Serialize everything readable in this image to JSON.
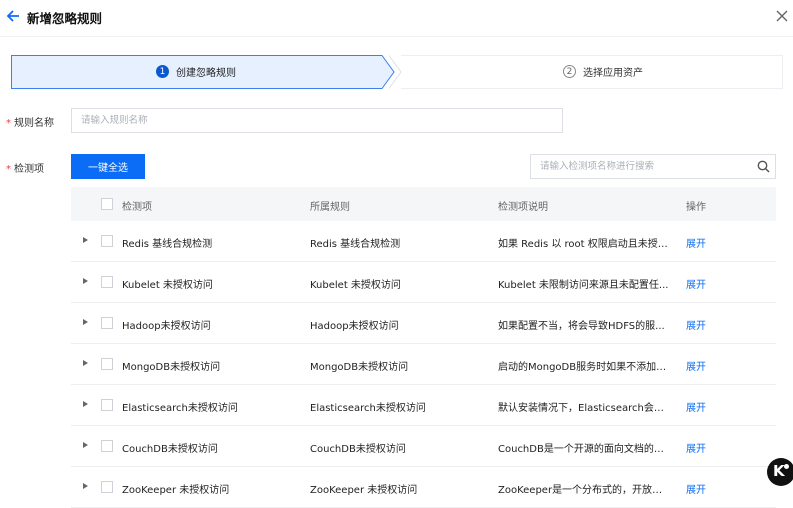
{
  "header": {
    "title": "新增忽略规则"
  },
  "steps": [
    {
      "num": "1",
      "label": "创建忽略规则"
    },
    {
      "num": "2",
      "label": "选择应用资产"
    }
  ],
  "form": {
    "name_label": "规则名称",
    "name_placeholder": "请输入规则名称",
    "items_label": "检测项",
    "required_mark": "*"
  },
  "toolbar": {
    "select_all_label": "一键全选",
    "search_placeholder": "请输入检测项名称进行搜索"
  },
  "table": {
    "columns": [
      "检测项",
      "所属规则",
      "检测项说明",
      "操作"
    ],
    "rows": [
      {
        "name": "Redis 基线合规检测",
        "rule": "Redis 基线合规检测",
        "desc": "如果 Redis 以 root 权限启动且未授权...",
        "op": "展开"
      },
      {
        "name": "Kubelet 未授权访问",
        "rule": "Kubelet 未授权访问",
        "desc": "Kubelet 未限制访问来源且未配置任...",
        "op": "展开"
      },
      {
        "name": "Hadoop未授权访问",
        "rule": "Hadoop未授权访问",
        "desc": "如果配置不当，将会导致HDFS的服...",
        "op": "展开"
      },
      {
        "name": "MongoDB未授权访问",
        "rule": "MongoDB未授权访问",
        "desc": "启动的MongoDB服务时如果不添加任...",
        "op": "展开"
      },
      {
        "name": "Elasticsearch未授权访问",
        "rule": "Elasticsearch未授权访问",
        "desc": "默认安装情况下，Elasticsearch会开...",
        "op": "展开"
      },
      {
        "name": "CouchDB未授权访问",
        "rule": "CouchDB未授权访问",
        "desc": "CouchDB是一个开源的面向文档的数...",
        "op": "展开"
      },
      {
        "name": "ZooKeeper 未授权访问",
        "rule": "ZooKeeper 未授权访问",
        "desc": "ZooKeeper是一个分布式的，开放源...",
        "op": "展开"
      }
    ]
  },
  "colors": {
    "accent": "#0b6df6",
    "step_active_bg": "#e6f0ff",
    "step_active_border": "#3d7ef0"
  }
}
